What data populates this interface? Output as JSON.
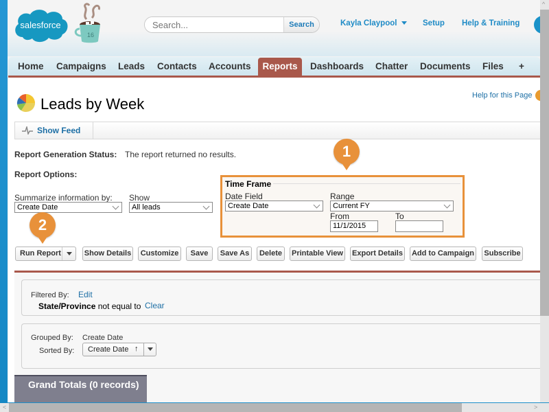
{
  "header": {
    "logo_text": "salesforce",
    "release_badge": "16",
    "search": {
      "placeholder": "Search...",
      "button_label": "Search"
    },
    "user_menu_label": "Kayla Claypool",
    "setup_label": "Setup",
    "help_training_label": "Help & Training"
  },
  "tabs": [
    {
      "label": "Home",
      "active": false
    },
    {
      "label": "Campaigns",
      "active": false
    },
    {
      "label": "Leads",
      "active": false
    },
    {
      "label": "Contacts",
      "active": false
    },
    {
      "label": "Accounts",
      "active": false
    },
    {
      "label": "Reports",
      "active": true
    },
    {
      "label": "Dashboards",
      "active": false
    },
    {
      "label": "Chatter",
      "active": false
    },
    {
      "label": "Documents",
      "active": false
    },
    {
      "label": "Files",
      "active": false
    },
    {
      "label": "+",
      "active": false
    }
  ],
  "page": {
    "title": "Leads by Week",
    "help_link": "Help for this Page",
    "show_feed_label": "Show Feed",
    "status_label": "Report Generation Status:",
    "status_text": "The report returned no results.",
    "options_label": "Report Options:",
    "summarize_label": "Summarize information by:",
    "summarize_value": "Create Date",
    "show_label": "Show",
    "show_value": "All leads",
    "time_frame": {
      "legend": "Time Frame",
      "date_field_label": "Date Field",
      "date_field_value": "Create Date",
      "range_label": "Range",
      "range_value": "Current FY",
      "from_label": "From",
      "from_value": "11/1/2015",
      "to_label": "To",
      "to_value": ""
    },
    "callouts": [
      "1",
      "2"
    ],
    "toolbar": {
      "run_report": "Run Report",
      "show_details": "Show Details",
      "customize": "Customize",
      "save": "Save",
      "save_as": "Save As",
      "delete": "Delete",
      "printable_view": "Printable View",
      "export_details": "Export Details",
      "add_to_campaign": "Add to Campaign",
      "subscribe": "Subscribe"
    },
    "filters": {
      "filtered_by_label": "Filtered By:",
      "edit_link": "Edit",
      "filter_field": "State/Province",
      "filter_operator": "not equal to",
      "clear_link": "Clear"
    },
    "grouping": {
      "grouped_by_label": "Grouped By:",
      "grouped_by_value": "Create Date",
      "sorted_by_label": "Sorted By:",
      "sorted_by_value": "Create Date",
      "sort_direction_glyph": "↑"
    },
    "grand_totals": "Grand Totals (0 records)"
  },
  "colors": {
    "brand_blue": "#1f8bc6",
    "reports_tab": "#a9584b",
    "callout_orange": "#e8913a",
    "link_blue": "#1d6fa5"
  }
}
